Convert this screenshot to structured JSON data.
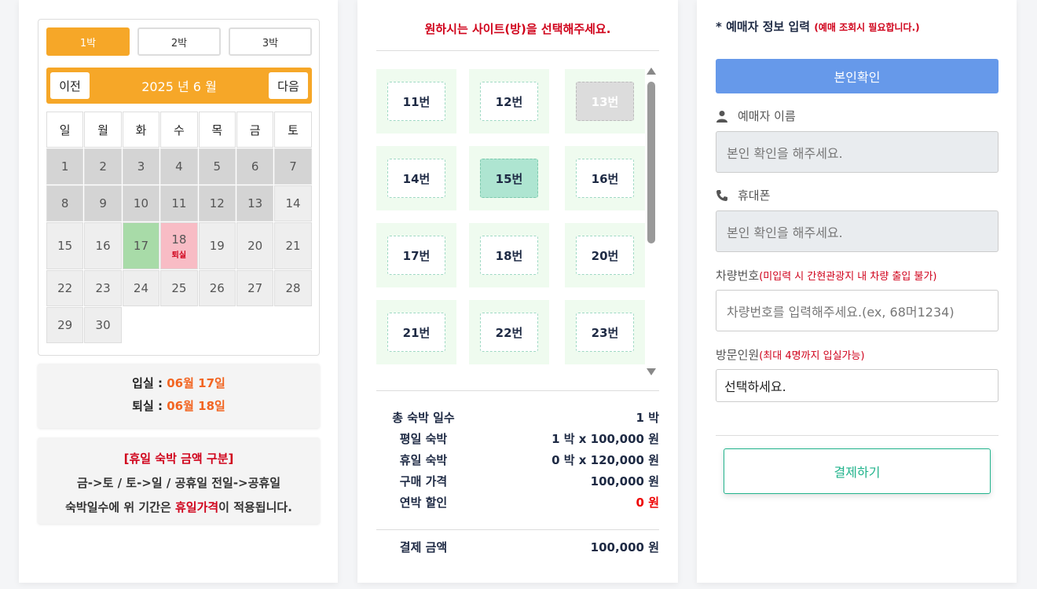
{
  "calendar": {
    "nights": [
      "1박",
      "2박",
      "3박"
    ],
    "prev_label": "이전",
    "next_label": "다음",
    "month_title": "2025 년 6 월",
    "weekdays": [
      "일",
      "월",
      "화",
      "수",
      "목",
      "금",
      "토"
    ],
    "days": [
      "1",
      "2",
      "3",
      "4",
      "5",
      "6",
      "7",
      "8",
      "9",
      "10",
      "11",
      "12",
      "13",
      "14",
      "15",
      "16",
      "17",
      "18",
      "19",
      "20",
      "21",
      "22",
      "23",
      "24",
      "25",
      "26",
      "27",
      "28",
      "29",
      "30"
    ],
    "checkout_tag": "퇴실"
  },
  "dates": {
    "checkin_label": "입실 :",
    "checkin_value": "06월 17일",
    "checkout_label": "퇴실 :",
    "checkout_value": "06월 18일"
  },
  "holiday_info": {
    "title": "[휴일 숙박 금액 구분]",
    "line1": "금->토 / 토->일 / 공휴일 전일->공휴일",
    "line2_pre": "숙박일수에 위 기간은 ",
    "line2_red": "휴일가격",
    "line2_post": "이 적용됩니다."
  },
  "site": {
    "title": "원하시는 사이트(방)을 선택해주세요.",
    "items": [
      "11번",
      "12번",
      "13번",
      "14번",
      "15번",
      "16번",
      "17번",
      "18번",
      "20번",
      "21번",
      "22번",
      "23번"
    ]
  },
  "summary": {
    "total_nights_label": "총 숙박 일수",
    "total_nights_value": "1 박",
    "weekday_label": "평일 숙박",
    "weekday_value": "1 박 x 100,000 원",
    "holiday_label": "휴일 숙박",
    "holiday_value": "0 박 x 120,000 원",
    "purchase_label": "구매 가격",
    "purchase_value": "100,000 원",
    "discount_label": "연박 할인",
    "discount_value": "0 원",
    "payment_label": "결제 금액",
    "payment_value": "100,000 원"
  },
  "form": {
    "title": "* 예매자 정보 입력",
    "title_note": "(예매 조회시 필요합니다.)",
    "verify_button": "본인확인",
    "name_label": "예매자 이름",
    "name_placeholder": "본인 확인을 해주세요.",
    "phone_label": "휴대폰",
    "phone_placeholder": "본인 확인을 해주세요.",
    "car_label": "차량번호",
    "car_note": "(미입력 시 간현관광지 내 차량 출입 불가)",
    "car_placeholder": "차량번호를 입력해주세요.(ex, 68머1234)",
    "visitor_label": "방문인원",
    "visitor_note": "(최대 4명까지 입실가능)",
    "visitor_select": "선택하세요.",
    "pay_button": "결제하기"
  }
}
